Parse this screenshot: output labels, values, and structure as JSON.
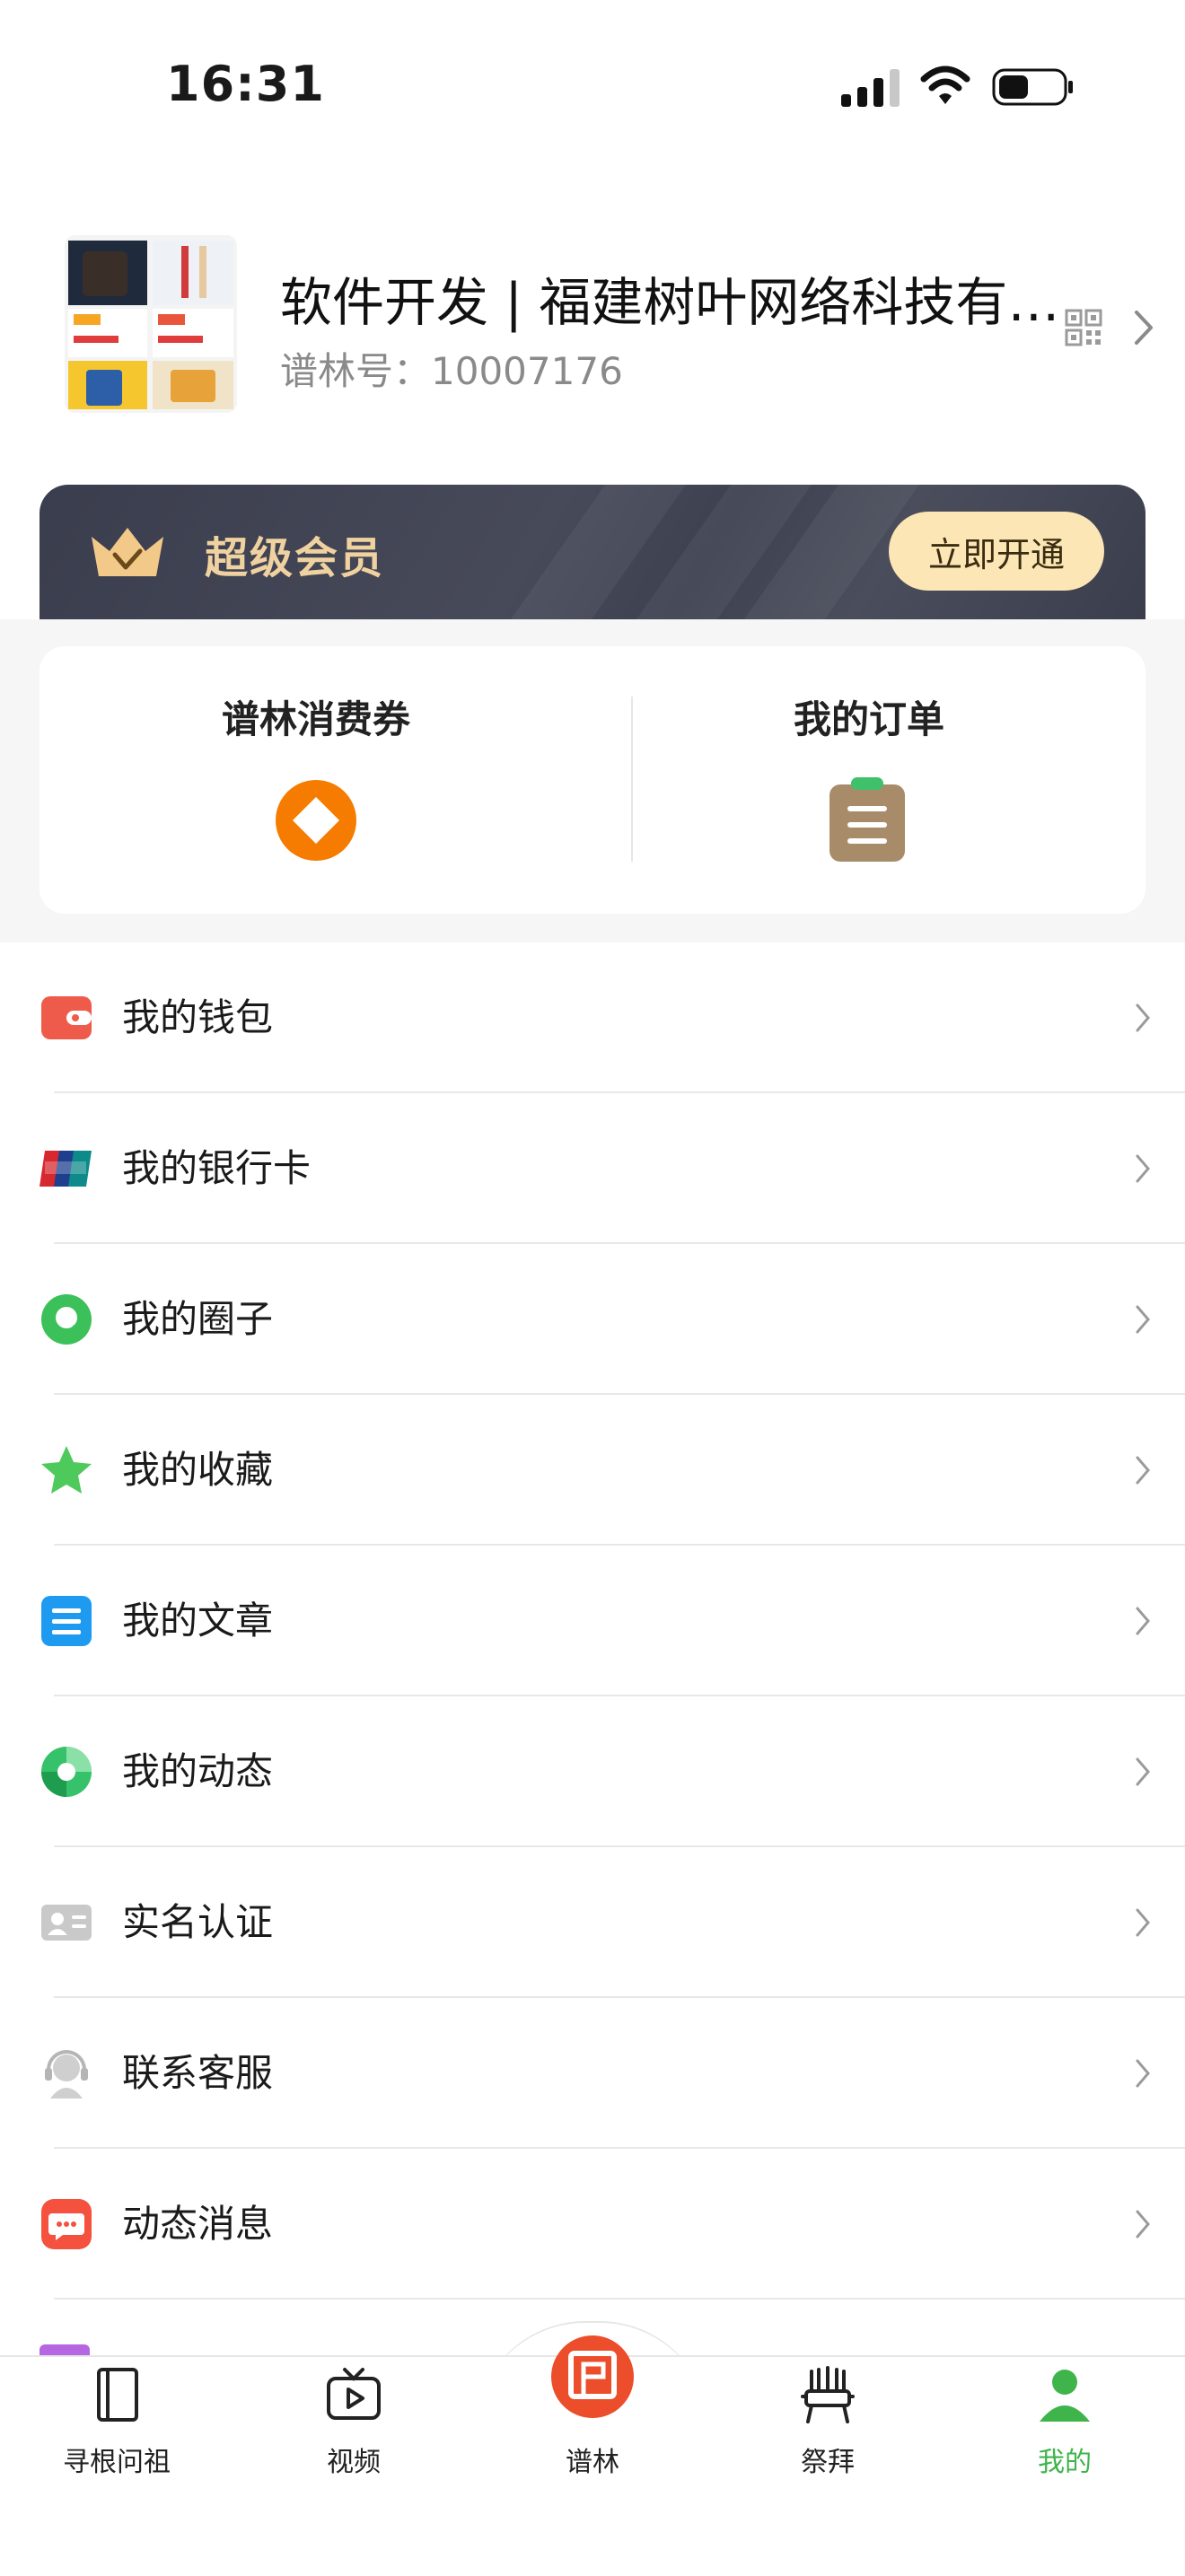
{
  "status_bar": {
    "time": "16:31"
  },
  "profile": {
    "name": "软件开发 | 福建树叶网络科技有限…",
    "id_label": "谱林号：",
    "id_value": "10007176"
  },
  "vip": {
    "label": "超级会员",
    "button": "立即开通"
  },
  "cards": {
    "coupon": "谱林消费券",
    "orders": "我的订单"
  },
  "menu": [
    {
      "label": "我的钱包",
      "icon": "wallet-icon"
    },
    {
      "label": "我的银行卡",
      "icon": "unionpay-card-icon"
    },
    {
      "label": "我的圈子",
      "icon": "circle-chat-icon"
    },
    {
      "label": "我的收藏",
      "icon": "star-icon"
    },
    {
      "label": "我的文章",
      "icon": "article-icon"
    },
    {
      "label": "我的动态",
      "icon": "moments-icon"
    },
    {
      "label": "实名认证",
      "icon": "id-card-icon"
    },
    {
      "label": "联系客服",
      "icon": "customer-service-icon"
    },
    {
      "label": "动态消息",
      "icon": "message-icon"
    }
  ],
  "tabs": [
    {
      "label": "寻根问祖",
      "icon": "book-icon"
    },
    {
      "label": "视频",
      "icon": "tv-play-icon"
    },
    {
      "label": "谱林",
      "icon": "pulin-logo-icon"
    },
    {
      "label": "祭拜",
      "icon": "altar-icon"
    },
    {
      "label": "我的",
      "icon": "person-icon"
    }
  ],
  "colors": {
    "accent_green": "#3fb44b",
    "vip_gold": "#f0d2a0",
    "vip_button": "#fde6b6",
    "coupon_orange": "#f57c00",
    "logo_red": "#ec4d2a"
  }
}
